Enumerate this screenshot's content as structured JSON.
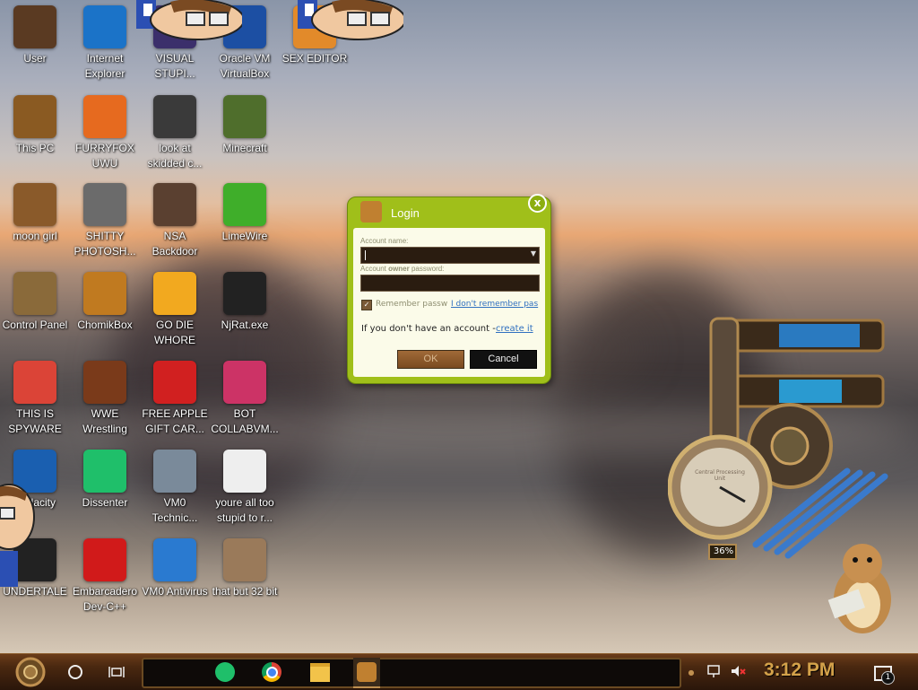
{
  "desktop_icons": [
    {
      "label": "User",
      "icon": "user-folder-icon",
      "color": "#5a3a22"
    },
    {
      "label": "Internet Explorer",
      "icon": "edge-browser-icon",
      "color": "#1b73c8"
    },
    {
      "label": "VISUAL STUPI...",
      "icon": "visual-studio-icon",
      "color": "#3b2f6b"
    },
    {
      "label": "Oracle VM VirtualBox",
      "icon": "virtualbox-icon",
      "color": "#1c4fa3"
    },
    {
      "label": "SEX EDITOR",
      "icon": "editor-icon",
      "color": "#e28a2a"
    },
    {
      "label": "This PC",
      "icon": "computer-icon",
      "color": "#8a5a22"
    },
    {
      "label": "FURRYFOX UWU",
      "icon": "firefox-icon",
      "color": "#e66a1f"
    },
    {
      "label": "look at skidded c...",
      "icon": "windows-stack-icon",
      "color": "#3a3a3a"
    },
    {
      "label": "Minecraft",
      "icon": "minecraft-icon",
      "color": "#4f6e2c"
    },
    {
      "label": "moon girl",
      "icon": "box-folder-icon",
      "color": "#8a5a2a"
    },
    {
      "label": "SHITTY PHOTOSH...",
      "icon": "gimp-icon",
      "color": "#6b6b6b"
    },
    {
      "label": "NSA Backdoor",
      "icon": "gear-panel-icon",
      "color": "#5a4030"
    },
    {
      "label": "LimeWire",
      "icon": "limewire-icon",
      "color": "#3fae2a"
    },
    {
      "label": "Control Panel",
      "icon": "lamp-icon",
      "color": "#8a6a3a"
    },
    {
      "label": "ChomikBox",
      "icon": "chomikbox-icon",
      "color": "#c07a20"
    },
    {
      "label": "GO DIE WHORE",
      "icon": "de-icon",
      "color": "#f2a91f"
    },
    {
      "label": "NjRat.exe",
      "icon": "skull-icon",
      "color": "#222222"
    },
    {
      "label": "THIS IS SPYWARE",
      "icon": "chrome-icon",
      "color": "#db4437"
    },
    {
      "label": "WWE Wrestling",
      "icon": "cabinet-icon",
      "color": "#7a3a1a"
    },
    {
      "label": "FREE APPLE GIFT CAR...",
      "icon": "apple-icon",
      "color": "#d12020"
    },
    {
      "label": "BOT COLLABVM...",
      "icon": "monitor-icon",
      "color": "#cc3366"
    },
    {
      "label": "Audacity",
      "icon": "audacity-icon",
      "color": "#1a5fb0"
    },
    {
      "label": "Dissenter",
      "icon": "dissenter-icon",
      "color": "#1fbf6a"
    },
    {
      "label": "VM0 Technic...",
      "icon": "technician-icon",
      "color": "#7a8a9a"
    },
    {
      "label": "youre all too stupid to r...",
      "icon": "face-drawing-icon",
      "color": "#eeeeee"
    },
    {
      "label": "UNDERTALE",
      "icon": "unity-icon",
      "color": "#222222"
    },
    {
      "label": "Embarcadero Dev-C++",
      "icon": "devcpp-icon",
      "color": "#d11a1a"
    },
    {
      "label": "VM0 Antivirus",
      "icon": "shield-icon",
      "color": "#2a7ad0"
    },
    {
      "label": "that but 32 bit",
      "icon": "portrait-icon",
      "color": "#9a7a5a"
    }
  ],
  "login": {
    "title": "Login",
    "close": "x",
    "account_name_label": "Account name:",
    "owner_password_label_1": "Account",
    "owner_password_label_bold": "owner",
    "owner_password_label_2": "password:",
    "remember_label": "Remember passw",
    "forgot_link": "I don't remember pas",
    "no_account_text": "If you don't have an account -",
    "create_link": "create it",
    "ok": "OK",
    "cancel": "Cancel"
  },
  "gadget": {
    "percent": "36%",
    "label": "Central Processing Unit"
  },
  "taskbar": {
    "clock": "3:12 PM",
    "notification_count": "1",
    "pinned": [
      "dissenter-icon",
      "chrome-icon",
      "file-explorer-icon",
      "chomikbox-icon"
    ]
  },
  "colors": {
    "login_green": "#a0bf1a",
    "taskbar_brown": "#4a2810",
    "clock_gold": "#d4a24a"
  }
}
